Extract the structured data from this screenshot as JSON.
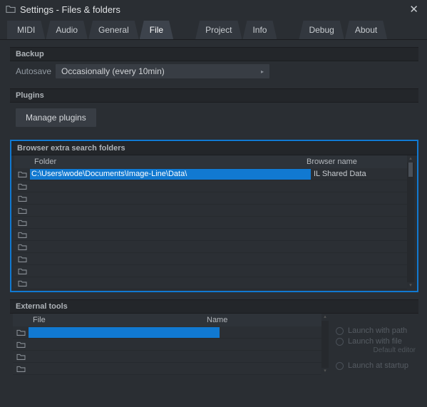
{
  "window": {
    "title": "Settings - Files & folders"
  },
  "tabs": {
    "midi": "MIDI",
    "audio": "Audio",
    "general": "General",
    "file": "File",
    "project": "Project",
    "info": "Info",
    "debug": "Debug",
    "about": "About",
    "active": "file"
  },
  "backup": {
    "title": "Backup",
    "autosave_label": "Autosave",
    "autosave_value": "Occasionally (every 10min)"
  },
  "plugins": {
    "title": "Plugins",
    "manage_label": "Manage plugins"
  },
  "browser": {
    "title": "Browser extra search folders",
    "col_folder": "Folder",
    "col_name": "Browser name",
    "rows": [
      {
        "path": "C:\\Users\\wode\\Documents\\Image-Line\\Data\\",
        "name": "IL Shared Data",
        "selected": true
      },
      {
        "path": "",
        "name": "",
        "selected": false
      },
      {
        "path": "",
        "name": "",
        "selected": false
      },
      {
        "path": "",
        "name": "",
        "selected": false
      },
      {
        "path": "",
        "name": "",
        "selected": false
      },
      {
        "path": "",
        "name": "",
        "selected": false
      },
      {
        "path": "",
        "name": "",
        "selected": false
      },
      {
        "path": "",
        "name": "",
        "selected": false
      },
      {
        "path": "",
        "name": "",
        "selected": false
      },
      {
        "path": "",
        "name": "",
        "selected": false
      }
    ]
  },
  "external": {
    "title": "External tools",
    "col_file": "File",
    "col_name": "Name",
    "rows": [
      {
        "file": "",
        "name": "",
        "selected": true
      },
      {
        "file": "",
        "name": "",
        "selected": false
      },
      {
        "file": "",
        "name": "",
        "selected": false
      },
      {
        "file": "",
        "name": "",
        "selected": false
      }
    ],
    "opt_path": "Launch with path",
    "opt_file": "Launch with file",
    "opt_sub": "Default editor",
    "opt_startup": "Launch at startup"
  }
}
